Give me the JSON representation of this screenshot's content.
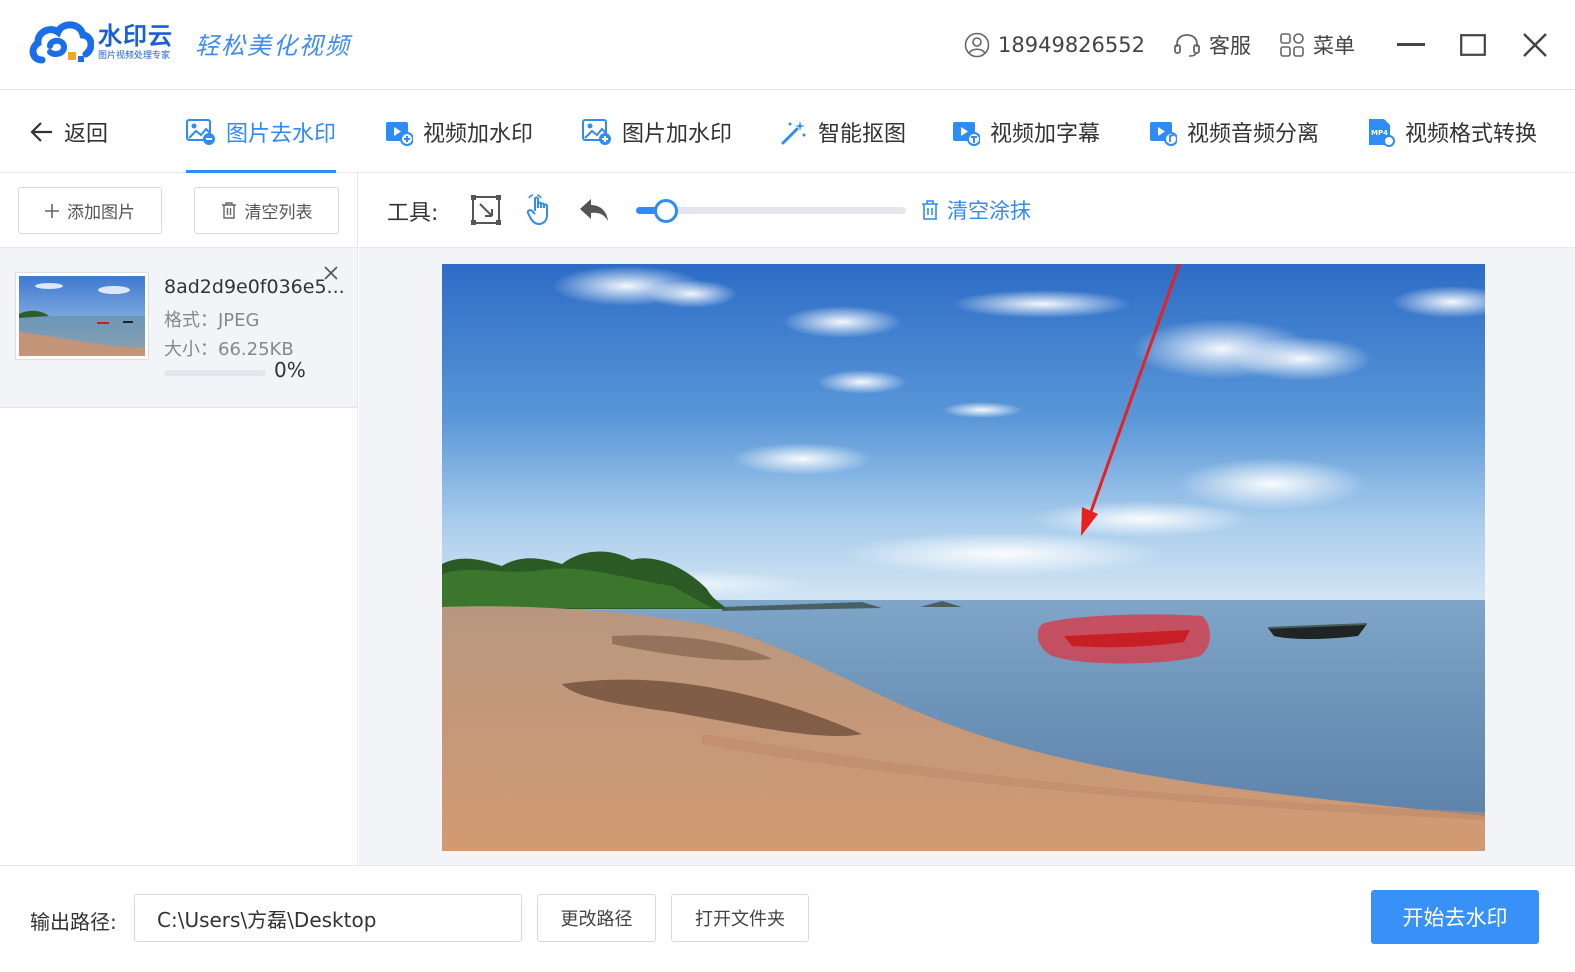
{
  "titlebar": {
    "logo_name": "水印云",
    "logo_sub": "图片视频处理专家",
    "slogan": "轻松美化视频",
    "phone": "18949826552",
    "service": "客服",
    "menu": "菜单"
  },
  "nav": {
    "back": "返回",
    "tabs": [
      {
        "label": "图片去水印",
        "icon": "image-remove-icon"
      },
      {
        "label": "视频加水印",
        "icon": "video-add-icon"
      },
      {
        "label": "图片加水印",
        "icon": "image-add-icon"
      },
      {
        "label": "智能抠图",
        "icon": "magic-wand-icon"
      },
      {
        "label": "视频加字幕",
        "icon": "video-subtitle-icon"
      },
      {
        "label": "视频音频分离",
        "icon": "video-audio-icon"
      },
      {
        "label": "视频格式转换",
        "icon": "mp4-convert-icon"
      }
    ],
    "active_index": 0
  },
  "left_panel": {
    "add_image": "添加图片",
    "clear_list": "清空列表",
    "file": {
      "name": "8ad2d9e0f036e5...",
      "format": "格式：JPEG",
      "size": "大小：66.25KB",
      "progress": 0,
      "percent": "0%"
    }
  },
  "editor": {
    "tools_label": "工具:",
    "brush_size_fraction": 0.11,
    "clear_smear": "清空涂抹"
  },
  "bottom": {
    "output_label": "输出路径:",
    "output_path": "C:\\Users\\方磊\\Desktop",
    "change_path": "更改路径",
    "open_folder": "打开文件夹",
    "start": "开始去水印"
  },
  "colors": {
    "accent": "#2f8bf5",
    "start_button": "#3891f6",
    "smear": "#e0303c",
    "arrow": "#e82020"
  }
}
